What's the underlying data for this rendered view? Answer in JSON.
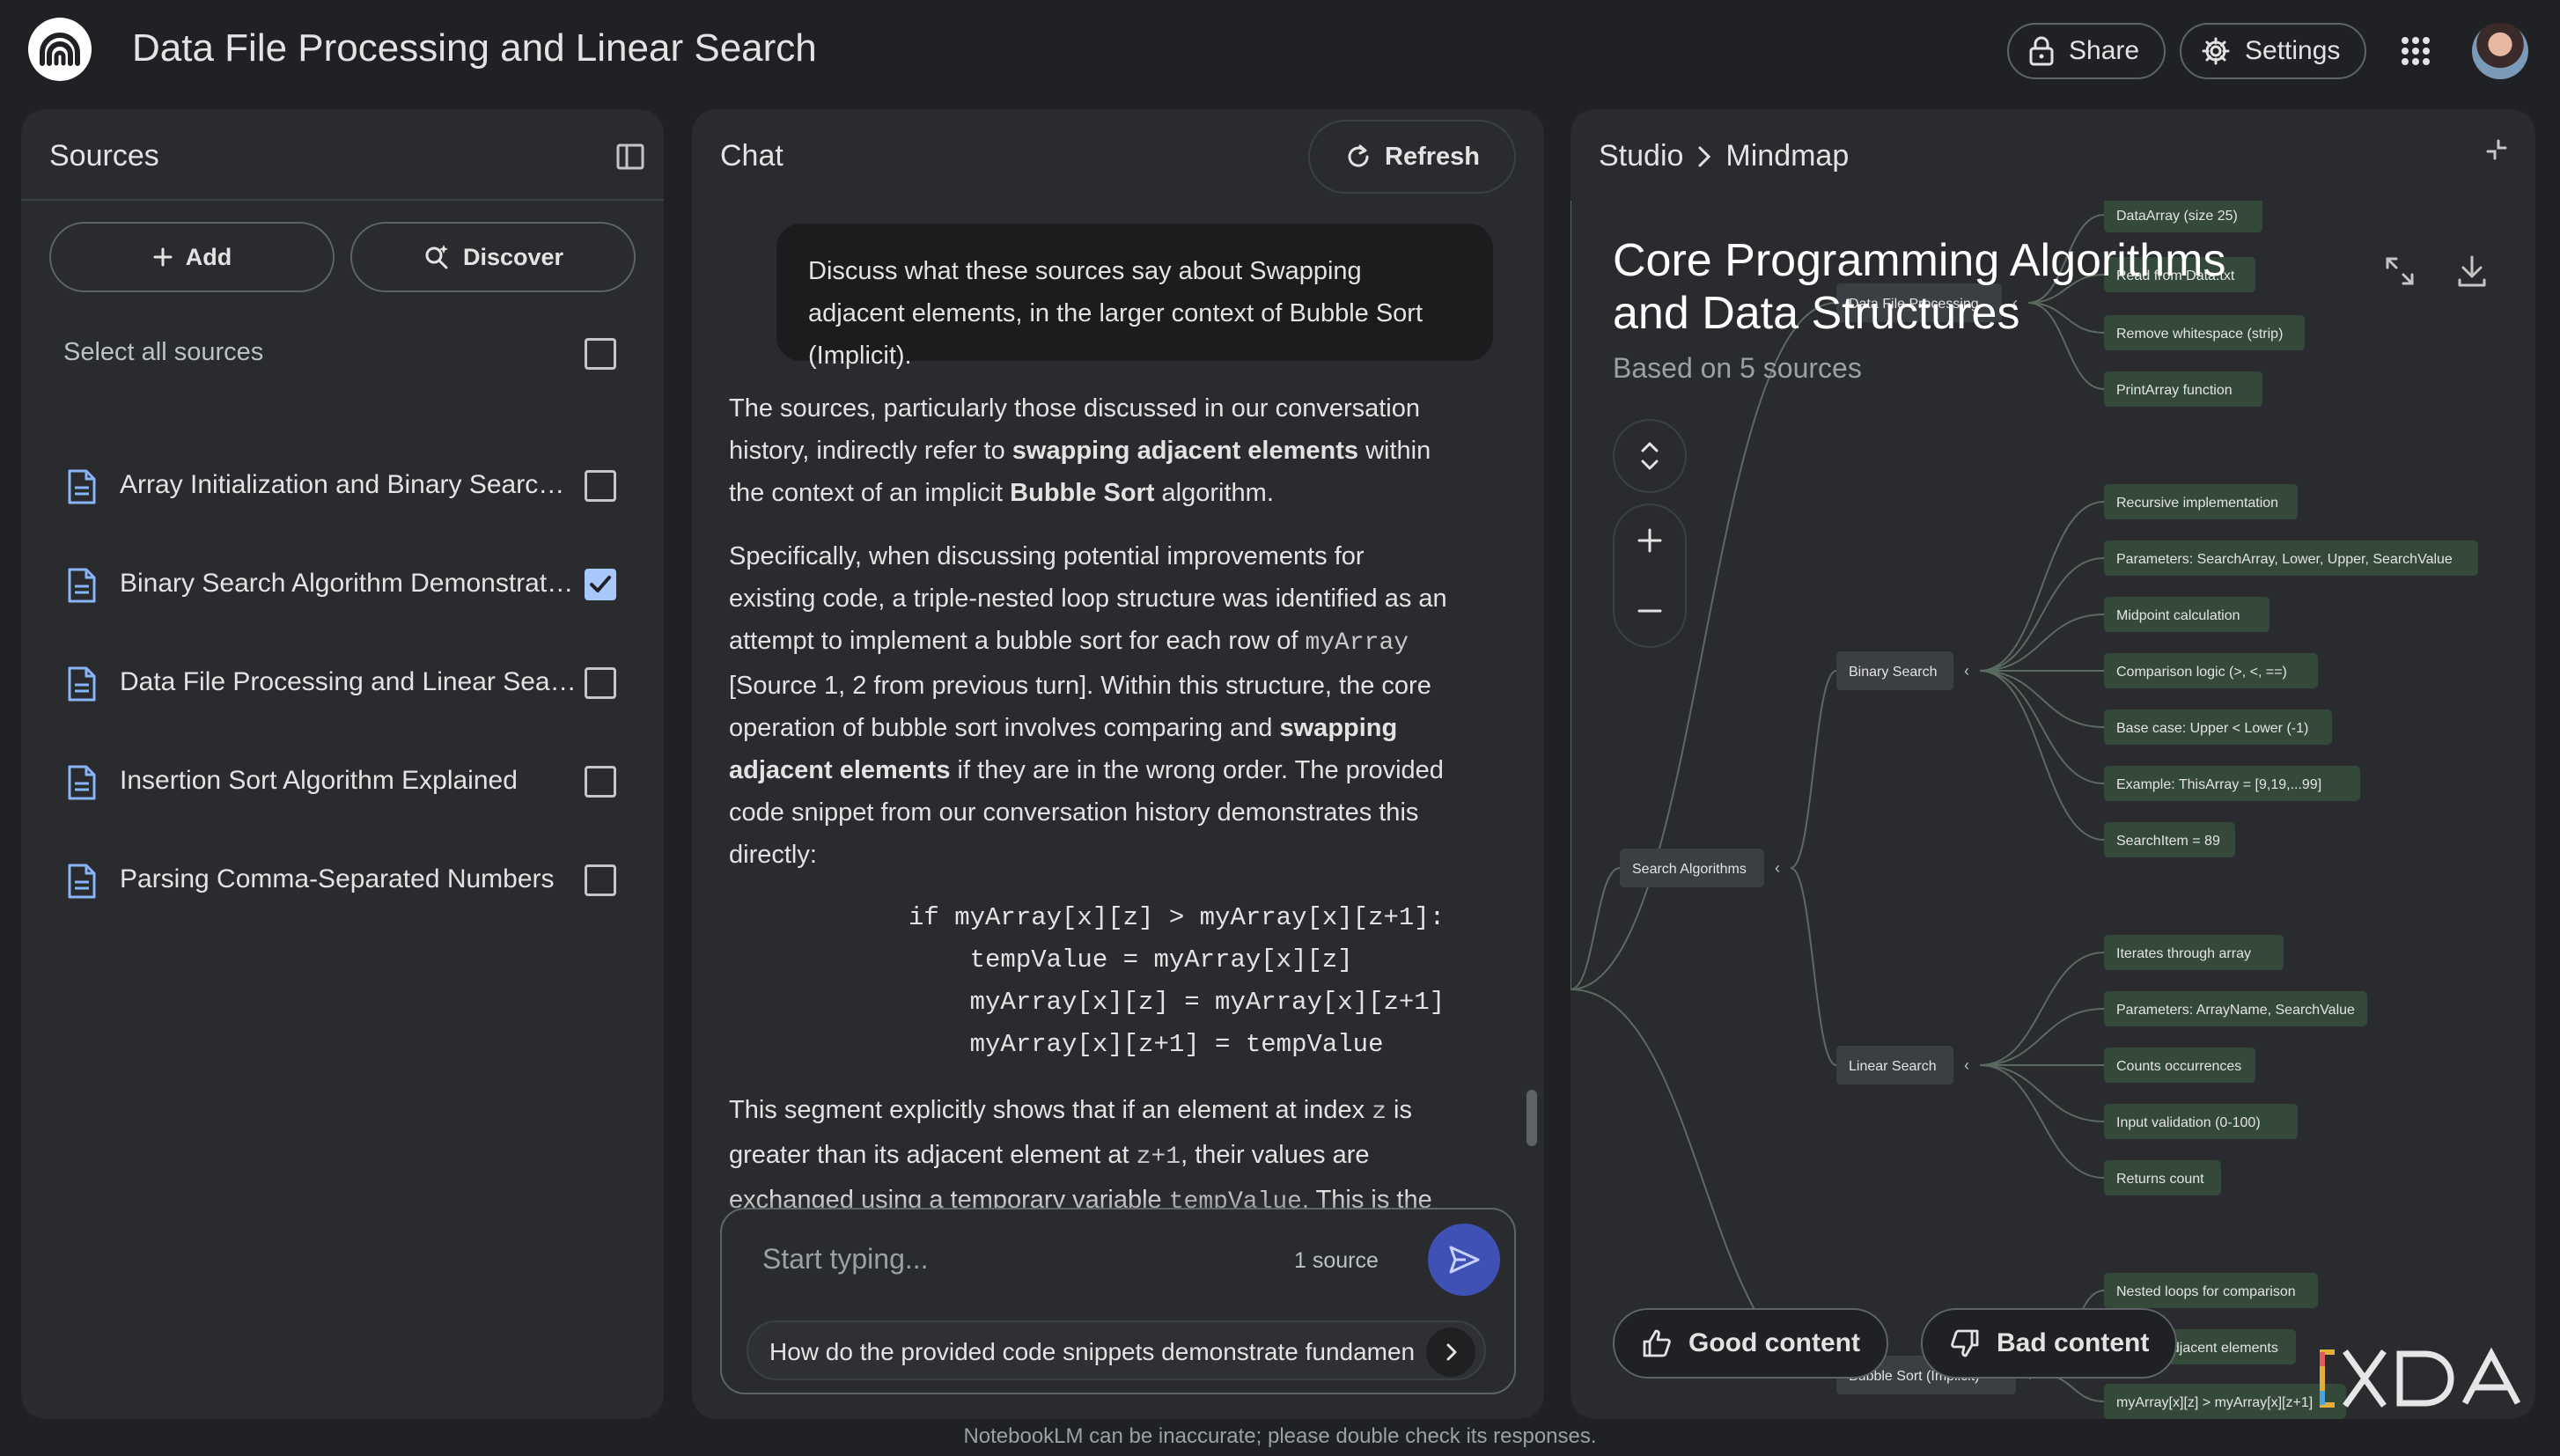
{
  "app": {
    "title": "Data File Processing and Linear Search",
    "share_label": "Share",
    "settings_label": "Settings"
  },
  "sources": {
    "title": "Sources",
    "add_label": "Add",
    "discover_label": "Discover",
    "select_all_label": "Select all sources",
    "items": [
      {
        "label": "Array Initialization and Binary Search ...",
        "checked": false
      },
      {
        "label": "Binary Search Algorithm Demonstration",
        "checked": true
      },
      {
        "label": "Data File Processing and Linear Search",
        "checked": false
      },
      {
        "label": "Insertion Sort Algorithm Explained",
        "checked": false
      },
      {
        "label": "Parsing Comma-Separated Numbers",
        "checked": false
      }
    ]
  },
  "chat": {
    "title": "Chat",
    "refresh_label": "Refresh",
    "user_message": "Discuss what these sources say about Swapping adjacent elements, in the larger context of Bubble Sort (Implicit).",
    "p1_a": "The sources, particularly those discussed in our conversation history, indirectly refer to ",
    "p1_b": "swapping adjacent elements",
    "p1_c": " within the context of an implicit ",
    "p1_d": "Bubble Sort",
    "p1_e": " algorithm.",
    "p2_a": "Specifically, when discussing potential improvements for existing code, a triple-nested loop structure was identified as an attempt to implement a bubble sort for each row of ",
    "p2_code": "myArray",
    "p2_b": " [Source 1, 2 from previous turn]. Within this structure, the core operation of bubble sort involves comparing and ",
    "p2_c": "swapping adjacent elements",
    "p2_d": " if they are in the wrong order. The provided code snippet from our conversation history demonstrates this directly:",
    "code_lines": [
      "if myArray[x][z] > myArray[x][z+1]:",
      "    tempValue = myArray[x][z]",
      "    myArray[x][z] = myArray[x][z+1]",
      "    myArray[x][z+1] = tempValue"
    ],
    "p3_a": "This segment explicitly shows that if an element at index ",
    "p3_code1": "z",
    "p3_b": " is greater than its adjacent element at ",
    "p3_code2": "z+1",
    "p3_c": ", their values are exchanged using a temporary variable ",
    "p3_code3": "tempValue",
    "p3_d": ". This is the",
    "input_placeholder": "Start typing...",
    "source_count": "1 source",
    "suggestion": "How do the provided code snippets demonstrate fundamen"
  },
  "studio": {
    "crumb_root": "Studio",
    "crumb_leaf": "Mindmap",
    "mindmap_title": "Core Programming Algorithms and Data Structures",
    "mindmap_subtitle": "Based on 5 sources",
    "good_label": "Good content",
    "bad_label": "Bad content",
    "nodes": {
      "data_array": "DataArray (size 25)",
      "read_from": "Read from Data.txt",
      "data_file": "Data File Processing",
      "remove_ws": "Remove whitespace (strip)",
      "print_array": "PrintArray function",
      "recursive": "Recursive implementation",
      "bs_params": "Parameters: SearchArray, Lower, Upper, SearchValue",
      "midpoint": "Midpoint calculation",
      "comparison": "Comparison logic (>, <, ==)",
      "base_case": "Base case: Upper < Lower (-1)",
      "example": "Example: ThisArray = [9,19,...99]",
      "search_item": "SearchItem = 89",
      "binary_search": "Binary Search",
      "search_algorithms": "Search Algorithms",
      "iterates": "Iterates through array",
      "ls_params": "Parameters: ArrayName, SearchValue",
      "counts": "Counts occurrences",
      "input_validation": "Input validation (0-100)",
      "returns_count": "Returns count",
      "linear_search": "Linear Search",
      "nested_loops": "Nested loops for comparison",
      "adjacent": "adjacent elements",
      "bubble_sort": "Bubble Sort (Implicit)",
      "my_array_cmp": "myArray[x][z] > myArray[x][z+1]"
    }
  },
  "footer": {
    "disclaimer": "NotebookLM can be inaccurate; please double check its responses."
  },
  "watermark": "XDA",
  "colors": {
    "background": "#202124",
    "panel": "#2a2b2e",
    "node": "#34493a",
    "accent_checkbox": "#a8c7fa",
    "send_button": "#3f51b5"
  }
}
